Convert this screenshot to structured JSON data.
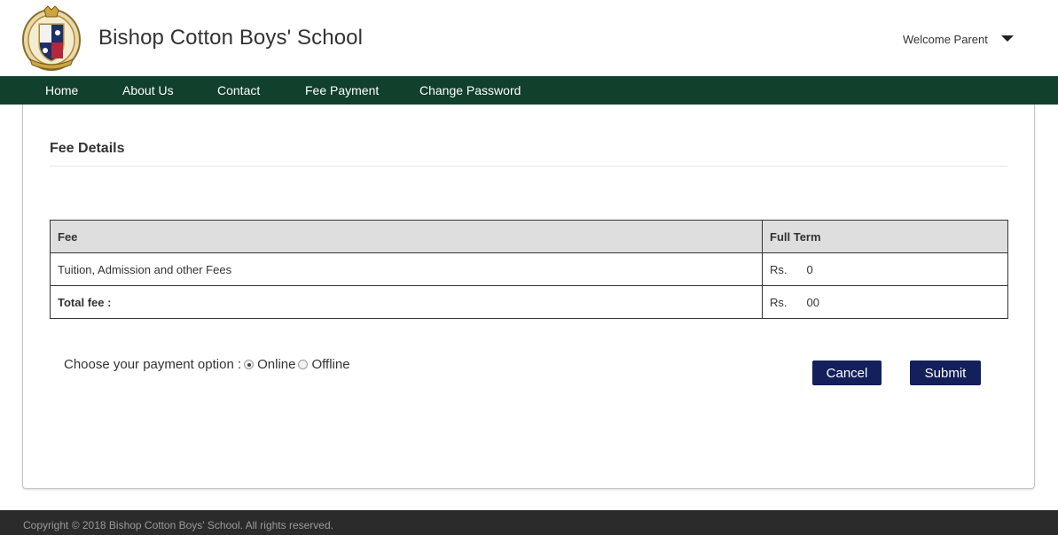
{
  "header": {
    "school_name": "Bishop Cotton Boys' School",
    "logo_icon": "school-crest-icon",
    "welcome_text": "Welcome Parent",
    "menu_icon": "caret-down-icon"
  },
  "nav": {
    "items": [
      {
        "label": "Home"
      },
      {
        "label": "About Us"
      },
      {
        "label": "Contact"
      },
      {
        "label": "Fee Payment"
      },
      {
        "label": "Change Password"
      }
    ]
  },
  "fee_details": {
    "title": "Fee Details",
    "table": {
      "headers": [
        "Fee",
        "Full Term"
      ],
      "rows": [
        {
          "fee": "Tuition, Admission and other Fees",
          "full_term_prefix": "Rs.",
          "full_term_suffix": "0"
        },
        {
          "fee": "Total fee :",
          "full_term_prefix": "Rs.",
          "full_term_suffix": "00"
        }
      ]
    }
  },
  "payment": {
    "label": "Choose your payment option :",
    "options": [
      {
        "label": "Online",
        "selected": true
      },
      {
        "label": "Offline",
        "selected": false
      }
    ]
  },
  "buttons": {
    "cancel": "Cancel",
    "submit": "Submit"
  },
  "footer": {
    "copyright": "Copyright © 2018 Bishop Cotton Boys' School. All rights reserved."
  },
  "colors": {
    "nav_background": "#11402d",
    "button_background": "#13205c",
    "table_header_background": "#dedede",
    "footer_background": "#2b2b2b"
  }
}
